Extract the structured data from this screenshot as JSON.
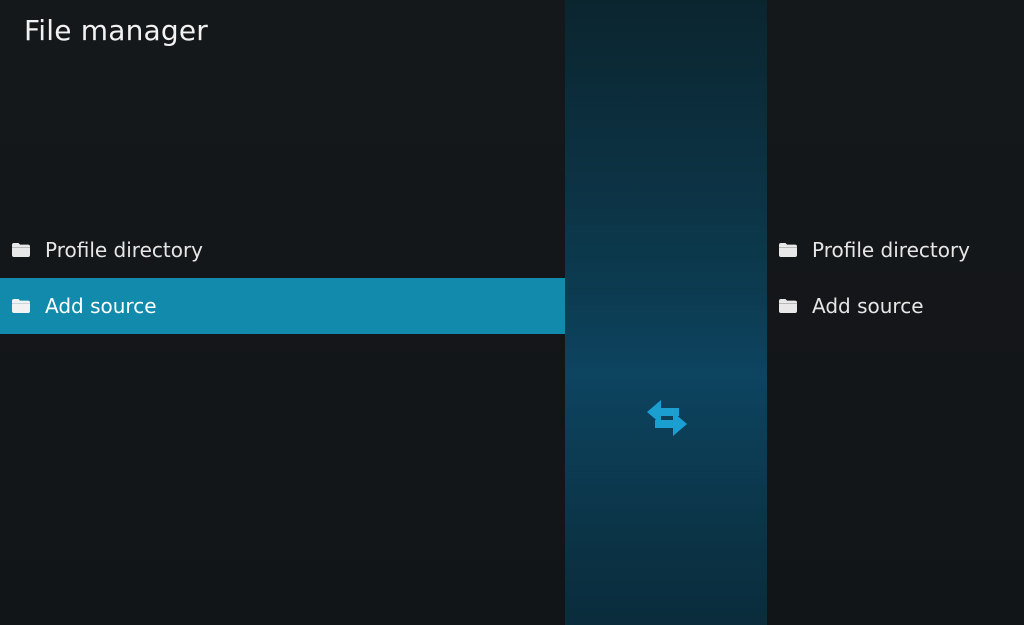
{
  "window": {
    "title": "File manager"
  },
  "left_pane": {
    "items": [
      {
        "label": "Profile directory",
        "icon": "folder-icon",
        "selected": false
      },
      {
        "label": "Add source",
        "icon": "folder-icon",
        "selected": true
      }
    ]
  },
  "right_pane": {
    "items": [
      {
        "label": "Profile directory",
        "icon": "folder-icon",
        "selected": false
      },
      {
        "label": "Add source",
        "icon": "folder-icon",
        "selected": false
      }
    ]
  },
  "divider": {
    "icon": "swap-arrows-icon"
  },
  "colors": {
    "background": "#131619",
    "selection": "#118aab",
    "accent_icon": "#1b9fd1",
    "text": "#e6e6e6",
    "title_text": "#f2f2f2"
  }
}
